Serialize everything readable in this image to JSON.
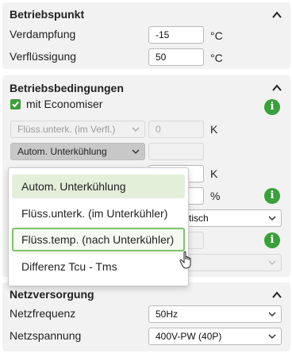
{
  "betriebspunkt": {
    "title": "Betriebspunkt",
    "verdampfung_label": "Verdampfung",
    "verdampfung_value": "-15",
    "verdampfung_unit": "°C",
    "verfluessigung_label": "Verflüssigung",
    "verfluessigung_value": "50",
    "verfluessigung_unit": "°C"
  },
  "betriebsbedingungen": {
    "title": "Betriebsbedingungen",
    "economiser_label": "mit Economiser",
    "economiser_checked": true,
    "row1_select": "Flüss.unterk. (im Verfl.)",
    "row1_value": "0",
    "row1_unit": "K",
    "row2_select": "Autom. Unterkühlung",
    "row2_value": "",
    "row3_unit": "K",
    "row4_unit": "%",
    "row5_select_partial": "tisch",
    "info_icon": "i"
  },
  "dropdown": {
    "options": [
      "Autom. Unterkühlung",
      "Flüss.unterk. (im Unterkühler)",
      "Flüss.temp. (nach Unterkühler)",
      "Differenz Tcu - Tms"
    ],
    "selected_index": 0,
    "hover_index": 2
  },
  "netzversorgung": {
    "title": "Netzversorgung",
    "netzfrequenz_label": "Netzfrequenz",
    "netzfrequenz_value": "50Hz",
    "netzspannung_label": "Netzspannung",
    "netzspannung_value": "400V-PW (40P)"
  },
  "colors": {
    "accent_green": "#3aa03a",
    "section_bg": "#f2f2f2"
  }
}
